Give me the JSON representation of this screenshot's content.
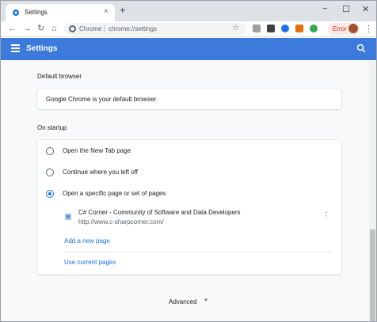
{
  "tab": {
    "title": "Settings",
    "close": "×"
  },
  "toolbar": {
    "omnibox_chrome_label": "Chrome",
    "omnibox_url": "chrome://settings",
    "error_label": "Error"
  },
  "header": {
    "title": "Settings"
  },
  "default_browser": {
    "section_title": "Default browser",
    "status_text": "Google Chrome is your default browser"
  },
  "on_startup": {
    "section_title": "On startup",
    "options": [
      {
        "label": "Open the New Tab page",
        "selected": false
      },
      {
        "label": "Continue where you left off",
        "selected": false
      },
      {
        "label": "Open a specific page or set of pages",
        "selected": true
      }
    ],
    "pages": [
      {
        "title": "C# Corner - Community of Software and Data Developers",
        "url": "http://www.c-sharpcorner.com/"
      }
    ],
    "add_new_page": "Add a new page",
    "use_current_pages": "Use current pages"
  },
  "advanced": {
    "label": "Advanced"
  },
  "colors": {
    "header": "#3c7bdb",
    "accent": "#1a73e8"
  },
  "icons": [
    "settings-gear-icon",
    "back-arrow-icon",
    "forward-arrow-icon",
    "reload-icon",
    "home-icon",
    "star-icon",
    "menu-icon",
    "search-icon",
    "kebab-menu-icon",
    "chevron-down-icon"
  ]
}
